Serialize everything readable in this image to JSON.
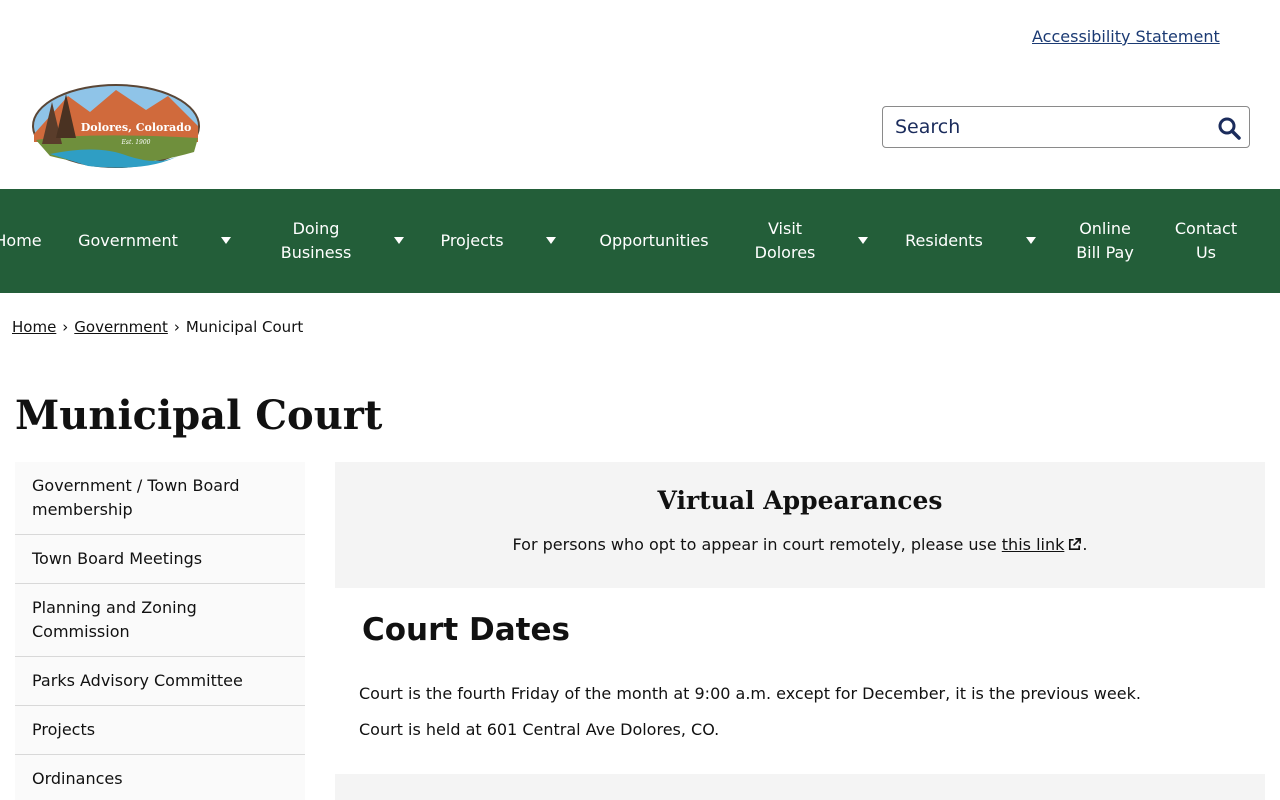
{
  "header": {
    "accessibility_link": "Accessibility Statement",
    "logo": {
      "name": "Dolores, Colorado",
      "est": "Est. 1900"
    },
    "search": {
      "placeholder": "Search",
      "icon": "search-icon"
    }
  },
  "nav": {
    "items": [
      {
        "label": "Home",
        "has_dropdown": false
      },
      {
        "label": "Government",
        "has_dropdown": true
      },
      {
        "label": "Doing Business",
        "has_dropdown": true
      },
      {
        "label": "Projects",
        "has_dropdown": true
      },
      {
        "label": "Opportunities",
        "has_dropdown": false
      },
      {
        "label": "Visit Dolores",
        "has_dropdown": true
      },
      {
        "label": "Residents",
        "has_dropdown": true
      },
      {
        "label": "Online Bill Pay",
        "has_dropdown": false
      },
      {
        "label": "Contact Us",
        "has_dropdown": false
      }
    ]
  },
  "breadcrumb": {
    "home": "Home",
    "government": "Government",
    "current": "Municipal Court",
    "separator": "›"
  },
  "page": {
    "title": "Municipal Court"
  },
  "sidebar": {
    "items": [
      "Government / Town Board membership",
      "Town Board Meetings",
      "Planning and Zoning Commission",
      "Parks Advisory Committee",
      "Projects",
      "Ordinances"
    ]
  },
  "virtual": {
    "title": "Virtual Appearances",
    "text_before": "For persons who opt to appear in court remotely, please use ",
    "link": "this link",
    "text_after": "."
  },
  "court": {
    "title": "Court Dates",
    "p1": "Court is the fourth Friday of the month at 9:00 a.m. except for December, it is the previous week.",
    "p2": "Court is held at 601 Central Ave Dolores, CO."
  },
  "colors": {
    "nav_bg": "#235e39",
    "link": "#1b3a73",
    "panel_bg": "#f4f4f4"
  }
}
